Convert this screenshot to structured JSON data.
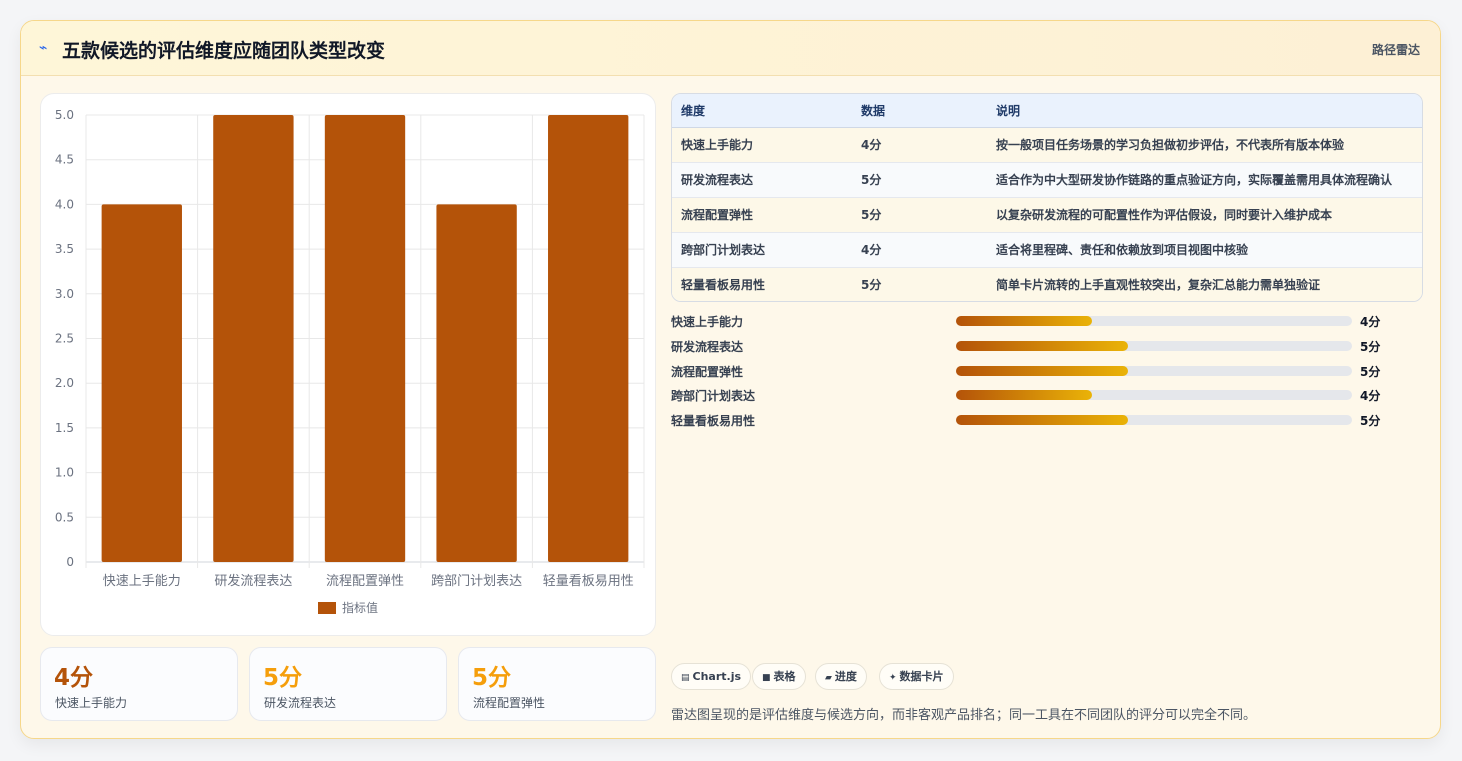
{
  "header": {
    "icon": "wave-icon",
    "title": "五款候选的评估维度应随团队类型改变",
    "tag": "路径雷达"
  },
  "chart_data": {
    "type": "bar",
    "categories": [
      "快速上手能力",
      "研发流程表达",
      "流程配置弹性",
      "跨部门计划表达",
      "轻量看板易用性"
    ],
    "series": [
      {
        "name": "指标值",
        "values": [
          4,
          5,
          5,
          4,
          5
        ],
        "color": "#b45309"
      }
    ],
    "yticks": [
      "0",
      "0.5",
      "1.0",
      "1.5",
      "2.0",
      "2.5",
      "3.0",
      "3.5",
      "4.0",
      "4.5",
      "5.0"
    ],
    "ylim": [
      0,
      5
    ],
    "grid": true,
    "legend": "bottom"
  },
  "kpis": [
    {
      "value": "4分",
      "label": "快速上手能力",
      "color": "#b45309"
    },
    {
      "value": "5分",
      "label": "研发流程表达",
      "color": "#f59e0b"
    },
    {
      "value": "5分",
      "label": "流程配置弹性",
      "color": "#f59e0b"
    }
  ],
  "table": {
    "headers": [
      "维度",
      "数据",
      "说明"
    ],
    "rows": [
      [
        "快速上手能力",
        "4分",
        "按一般项目任务场景的学习负担做初步评估，不代表所有版本体验"
      ],
      [
        "研发流程表达",
        "5分",
        "适合作为中大型研发协作链路的重点验证方向，实际覆盖需用具体流程确认"
      ],
      [
        "流程配置弹性",
        "5分",
        "以复杂研发流程的可配置性作为评估假设，同时要计入维护成本"
      ],
      [
        "跨部门计划表达",
        "4分",
        "适合将里程碑、责任和依赖放到项目视图中核验"
      ],
      [
        "轻量看板易用性",
        "5分",
        "简单卡片流转的上手直观性较突出，复杂汇总能力需单独验证"
      ]
    ]
  },
  "progress": [
    {
      "label": "快速上手能力",
      "value": "4分",
      "fraction": 0.344
    },
    {
      "label": "研发流程表达",
      "value": "5分",
      "fraction": 0.434
    },
    {
      "label": "流程配置弹性",
      "value": "5分",
      "fraction": 0.434
    },
    {
      "label": "跨部门计划表达",
      "value": "4分",
      "fraction": 0.344
    },
    {
      "label": "轻量看板易用性",
      "value": "5分",
      "fraction": 0.434
    }
  ],
  "chips": [
    {
      "icon": "chart-icon",
      "glyph": "▤",
      "label": "Chart.js"
    },
    {
      "icon": "table-icon",
      "glyph": "■",
      "label": "表格"
    },
    {
      "icon": "progress-icon",
      "glyph": "▰",
      "label": "进度"
    },
    {
      "icon": "sparkle-icon",
      "glyph": "✦",
      "label": "数据卡片"
    }
  ],
  "note": "雷达图呈现的是评估维度与候选方向，而非客观产品排名；同一工具在不同团队的评分可以完全不同。"
}
